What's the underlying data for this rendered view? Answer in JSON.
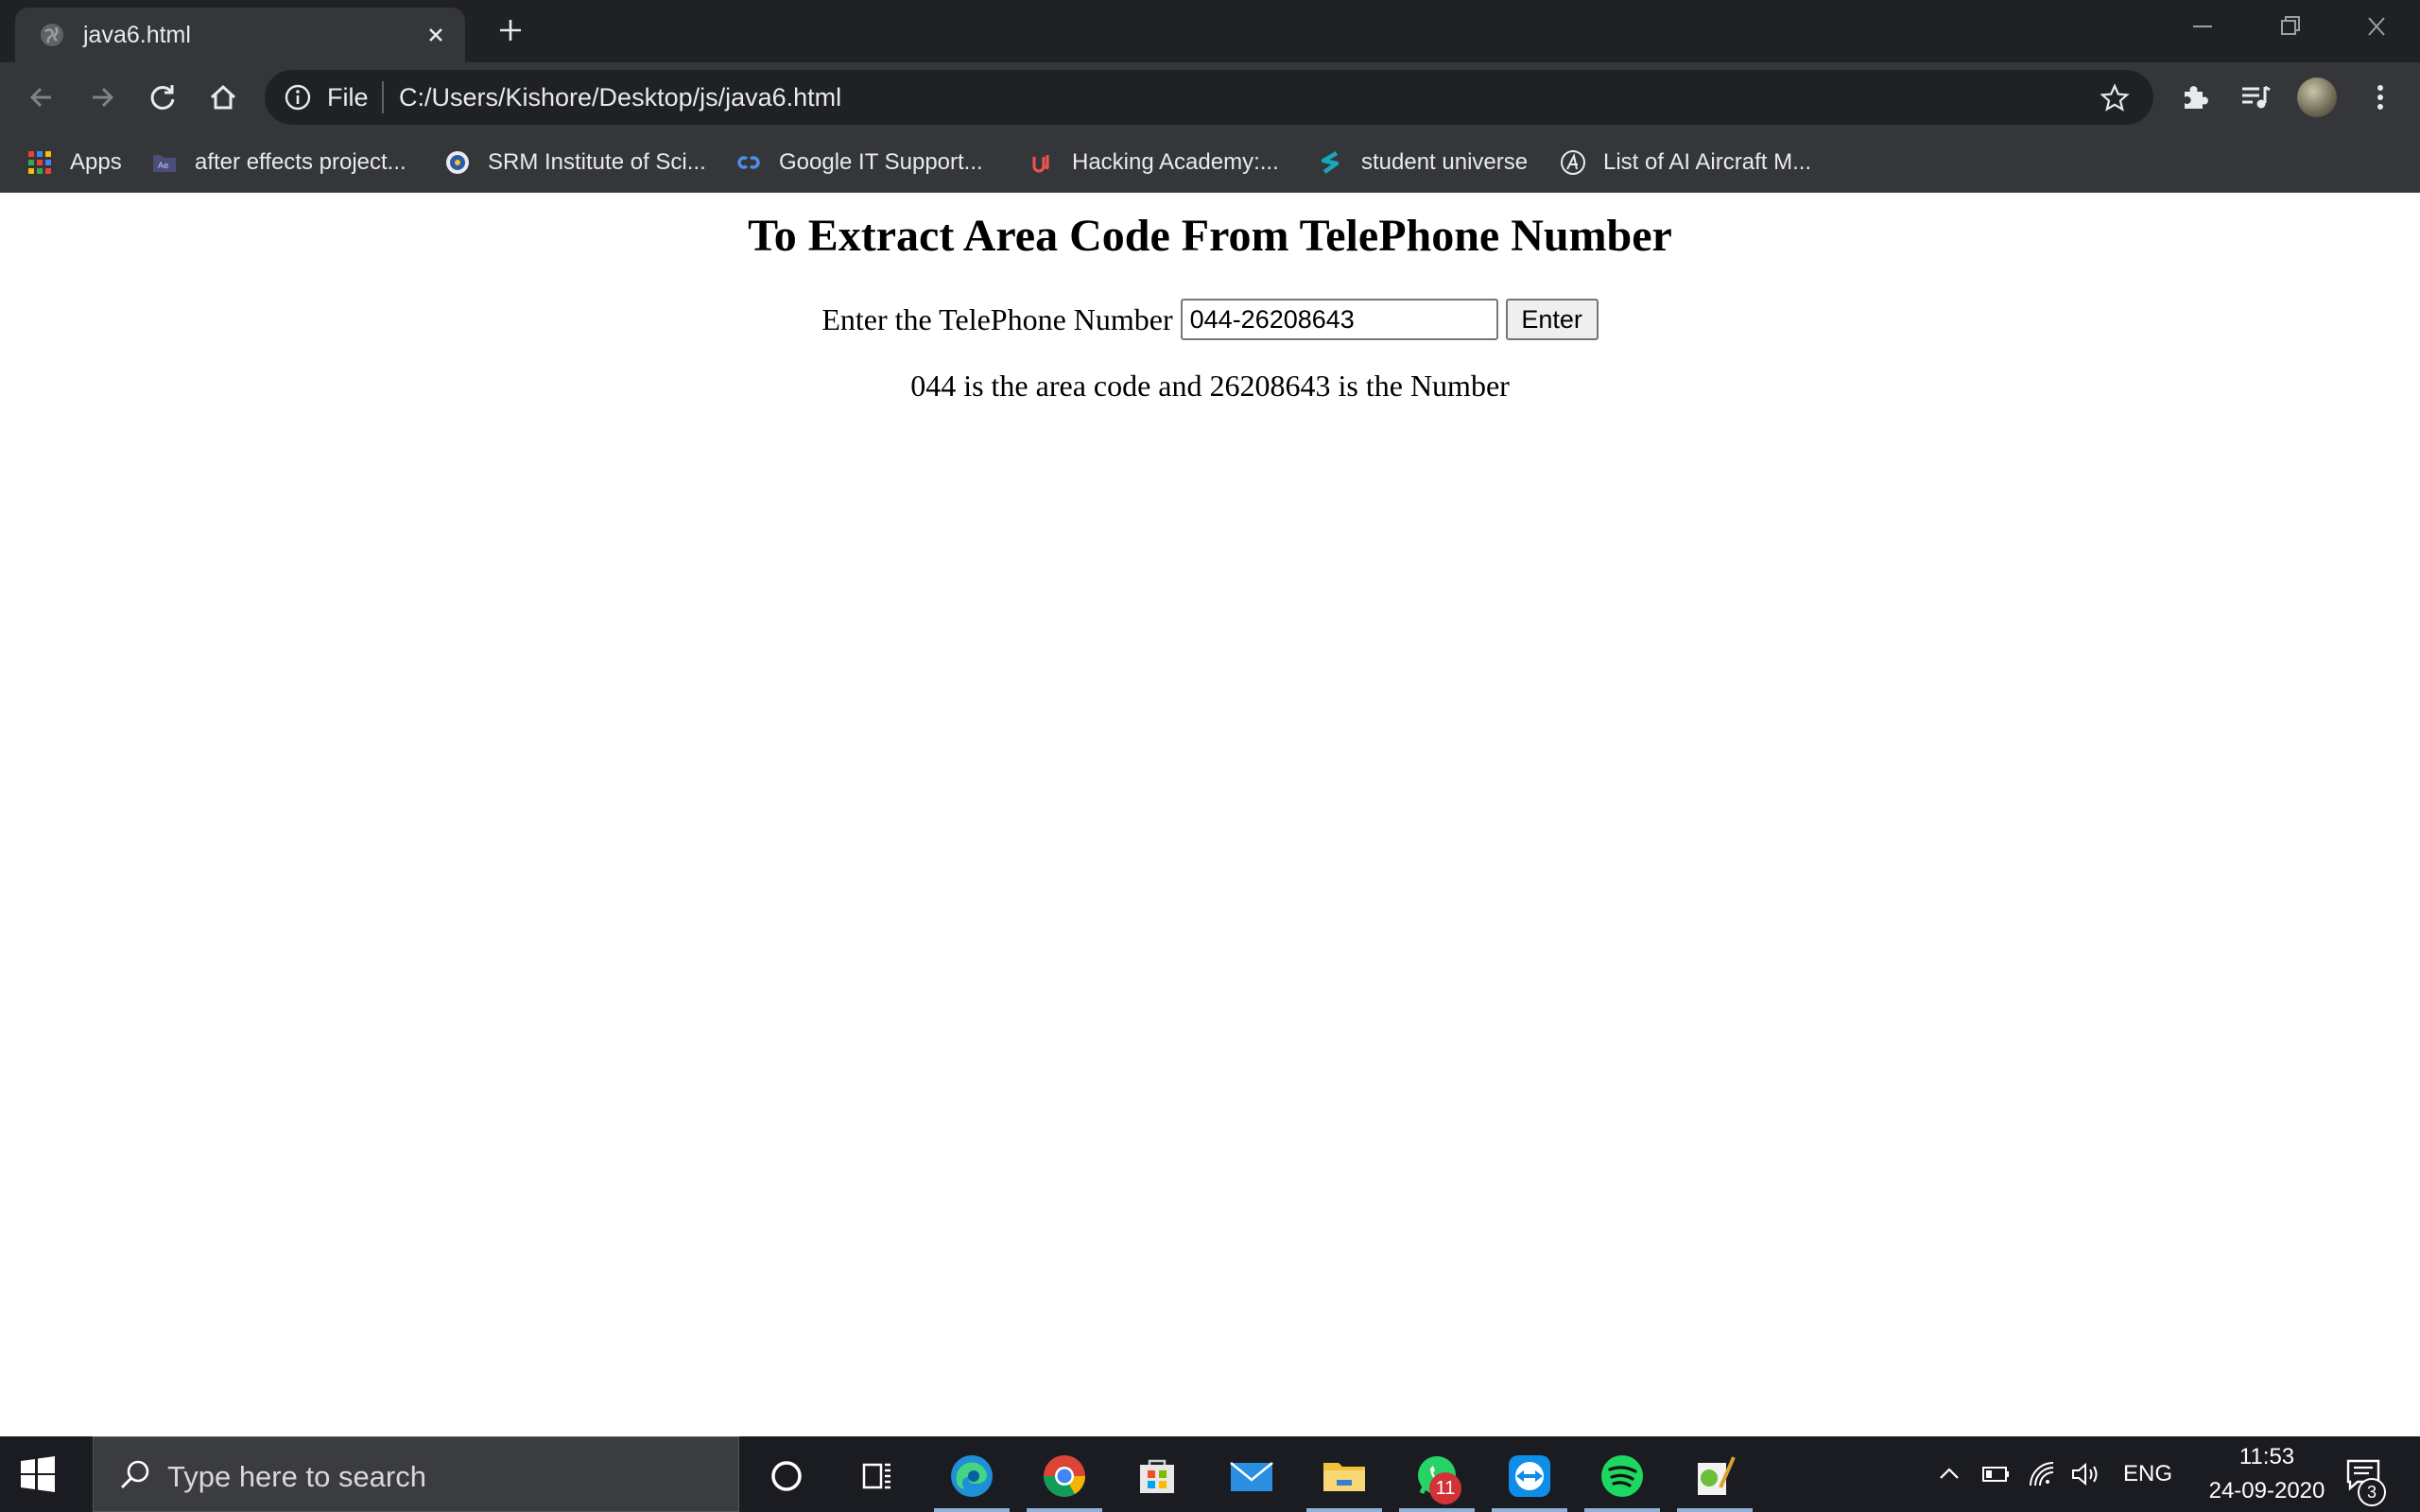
{
  "browser": {
    "tab_title": "java6.html",
    "scheme_label": "File",
    "url": "C:/Users/Kishore/Desktop/js/java6.html",
    "bookmarks": [
      {
        "label": "Apps",
        "icon": "apps-grid-icon"
      },
      {
        "label": "after effects project...",
        "icon": "after-effects-icon"
      },
      {
        "label": "SRM Institute of Sci...",
        "icon": "srm-logo-icon"
      },
      {
        "label": "Google IT Support...",
        "icon": "coursera-icon"
      },
      {
        "label": "Hacking Academy:...",
        "icon": "udemy-icon"
      },
      {
        "label": "student universe",
        "icon": "student-universe-icon"
      },
      {
        "label": "List of AI Aircraft M...",
        "icon": "aircraft-site-icon"
      }
    ]
  },
  "page": {
    "heading": "To Extract Area Code From TelePhone Number",
    "input_label": "Enter the TelePhone Number",
    "input_value": "044-26208643",
    "button_label": "Enter",
    "result": "044 is the area code and 26208643 is the Number"
  },
  "taskbar": {
    "search_placeholder": "Type here to search",
    "whatsapp_badge": "11",
    "language": "ENG",
    "time": "11:53",
    "date": "24-09-2020",
    "notification_count": "3"
  },
  "colors": {
    "tab_strip": "#202124",
    "toolbar": "#35363a",
    "omnibox": "#202124",
    "taskbar": "#1a1c21",
    "badge_red": "#d13438"
  }
}
